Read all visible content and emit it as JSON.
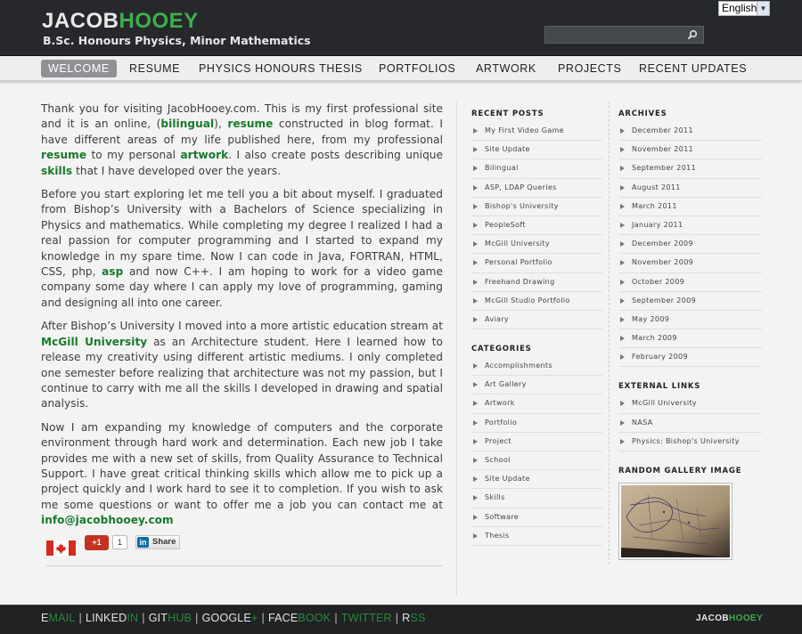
{
  "header": {
    "brand_part1": "JACOB",
    "brand_part2": "HOOEY",
    "subtitle": "B.Sc. Honours Physics, Minor Mathematics",
    "language": "English",
    "search_placeholder": ""
  },
  "nav": {
    "items": [
      {
        "label": "WELCOME",
        "active": true
      },
      {
        "label": "RESUME"
      },
      {
        "label": "PHYSICS HONOURS THESIS"
      },
      {
        "label": "PORTFOLIOS"
      },
      {
        "label": "ARTWORK"
      },
      {
        "label": "PROJECTS"
      },
      {
        "label": "RECENT UPDATES"
      }
    ]
  },
  "content": {
    "p1": {
      "t1": "Thank you for visiting JacobHooey.com. This is my first professional site and it is an online, (",
      "l1": "bilingual",
      "t2": "), ",
      "l2": "resume",
      "t3": " constructed in blog format. I have different areas of my life published here, from my professional ",
      "l3": "resume",
      "t4": " to my personal ",
      "l4": "artwork",
      "t5": ". I also create posts describing unique ",
      "l5": "skills",
      "t6": " that I have developed over the years."
    },
    "p2": {
      "t1": "Before you start exploring let me tell you a bit about myself. I graduated from Bishop’s University with a Bachelors of Science specializing in Physics and mathematics. While completing my degree I realized I had a real passion for computer programming and I started to expand my knowledge in my spare time. Now I can code in Java, FORTRAN, HTML, CSS, php, ",
      "l1": "asp",
      "t2": " and now C++. I am hoping to work for a video game company some day where I can apply my love of programming, gaming and designing all into one career."
    },
    "p3": {
      "t1": "After Bishop’s University I moved into a more artistic education stream at ",
      "l1": "McGill University",
      "t2": " as an Architecture student. Here I learned how to release my creativity using different artistic mediums. I only completed one semester before realizing that architecture was not my passion, but I continue to carry with me all the skills I developed in drawing and spatial analysis."
    },
    "p4": {
      "t1": "Now I am expanding my knowledge of computers and the corporate environment through hard work and determination. Each new job I take provides me with a new set of skills, from Quality Assurance to Technical Support. I have great critical thinking skills which allow me to pick up a project quickly and I work hard to see it to completion. If you wish to ask me some questions or want to offer me a job you can contact me at ",
      "l1": "info@jacobhooey.com"
    }
  },
  "social": {
    "gplus_label": "+1",
    "gplus_count": "1",
    "linkedin_icon": "in",
    "linkedin_label": "Share"
  },
  "sidebar": {
    "recent_posts_title": "RECENT POSTS",
    "recent_posts": [
      "My First Video Game",
      "Site Update",
      "Bilingual",
      "ASP, LDAP Queries",
      "Bishop's University",
      "PeopleSoft",
      "McGill University",
      "Personal Portfolio",
      "Freehand Drawing",
      "McGill Studio Portfolio",
      "Aviary"
    ],
    "categories_title": "CATEGORIES",
    "categories": [
      "Accomplishments",
      "Art Gallery",
      "Artwork",
      "Portfolio",
      "Project",
      "School",
      "Site Update",
      "Skills",
      "Software",
      "Thesis"
    ],
    "archives_title": "ARCHIVES",
    "archives": [
      "December 2011",
      "November 2011",
      "September 2011",
      "August 2011",
      "March 2011",
      "January 2011",
      "December 2009",
      "November 2009",
      "October 2009",
      "September 2009",
      "May 2009",
      "March 2009",
      "February 2009"
    ],
    "external_title": "EXTERNAL LINKS",
    "external": [
      "McGill University",
      "NASA",
      "Physics: Bishop's University"
    ],
    "gallery_title": "RANDOM GALLERY IMAGE"
  },
  "footer": {
    "email_a": "E",
    "email_b": "MAIL",
    "linkedin_a": "LINKED",
    "linkedin_b": "IN",
    "github_a": "GIT",
    "github_b": "HUB",
    "google_a": "GOOGLE",
    "google_b": "+",
    "facebook_a": "FACE",
    "facebook_b": "BOOK",
    "twitter": "TWITTER",
    "rss_a": "R",
    "rss_b": "SS",
    "separator": "|",
    "logo_part1": "JACOB",
    "logo_part2": "HOOEY"
  },
  "colors": {
    "accent_green": "#3db04a",
    "link_green": "#177a2a",
    "header_bg": "#26282b"
  }
}
